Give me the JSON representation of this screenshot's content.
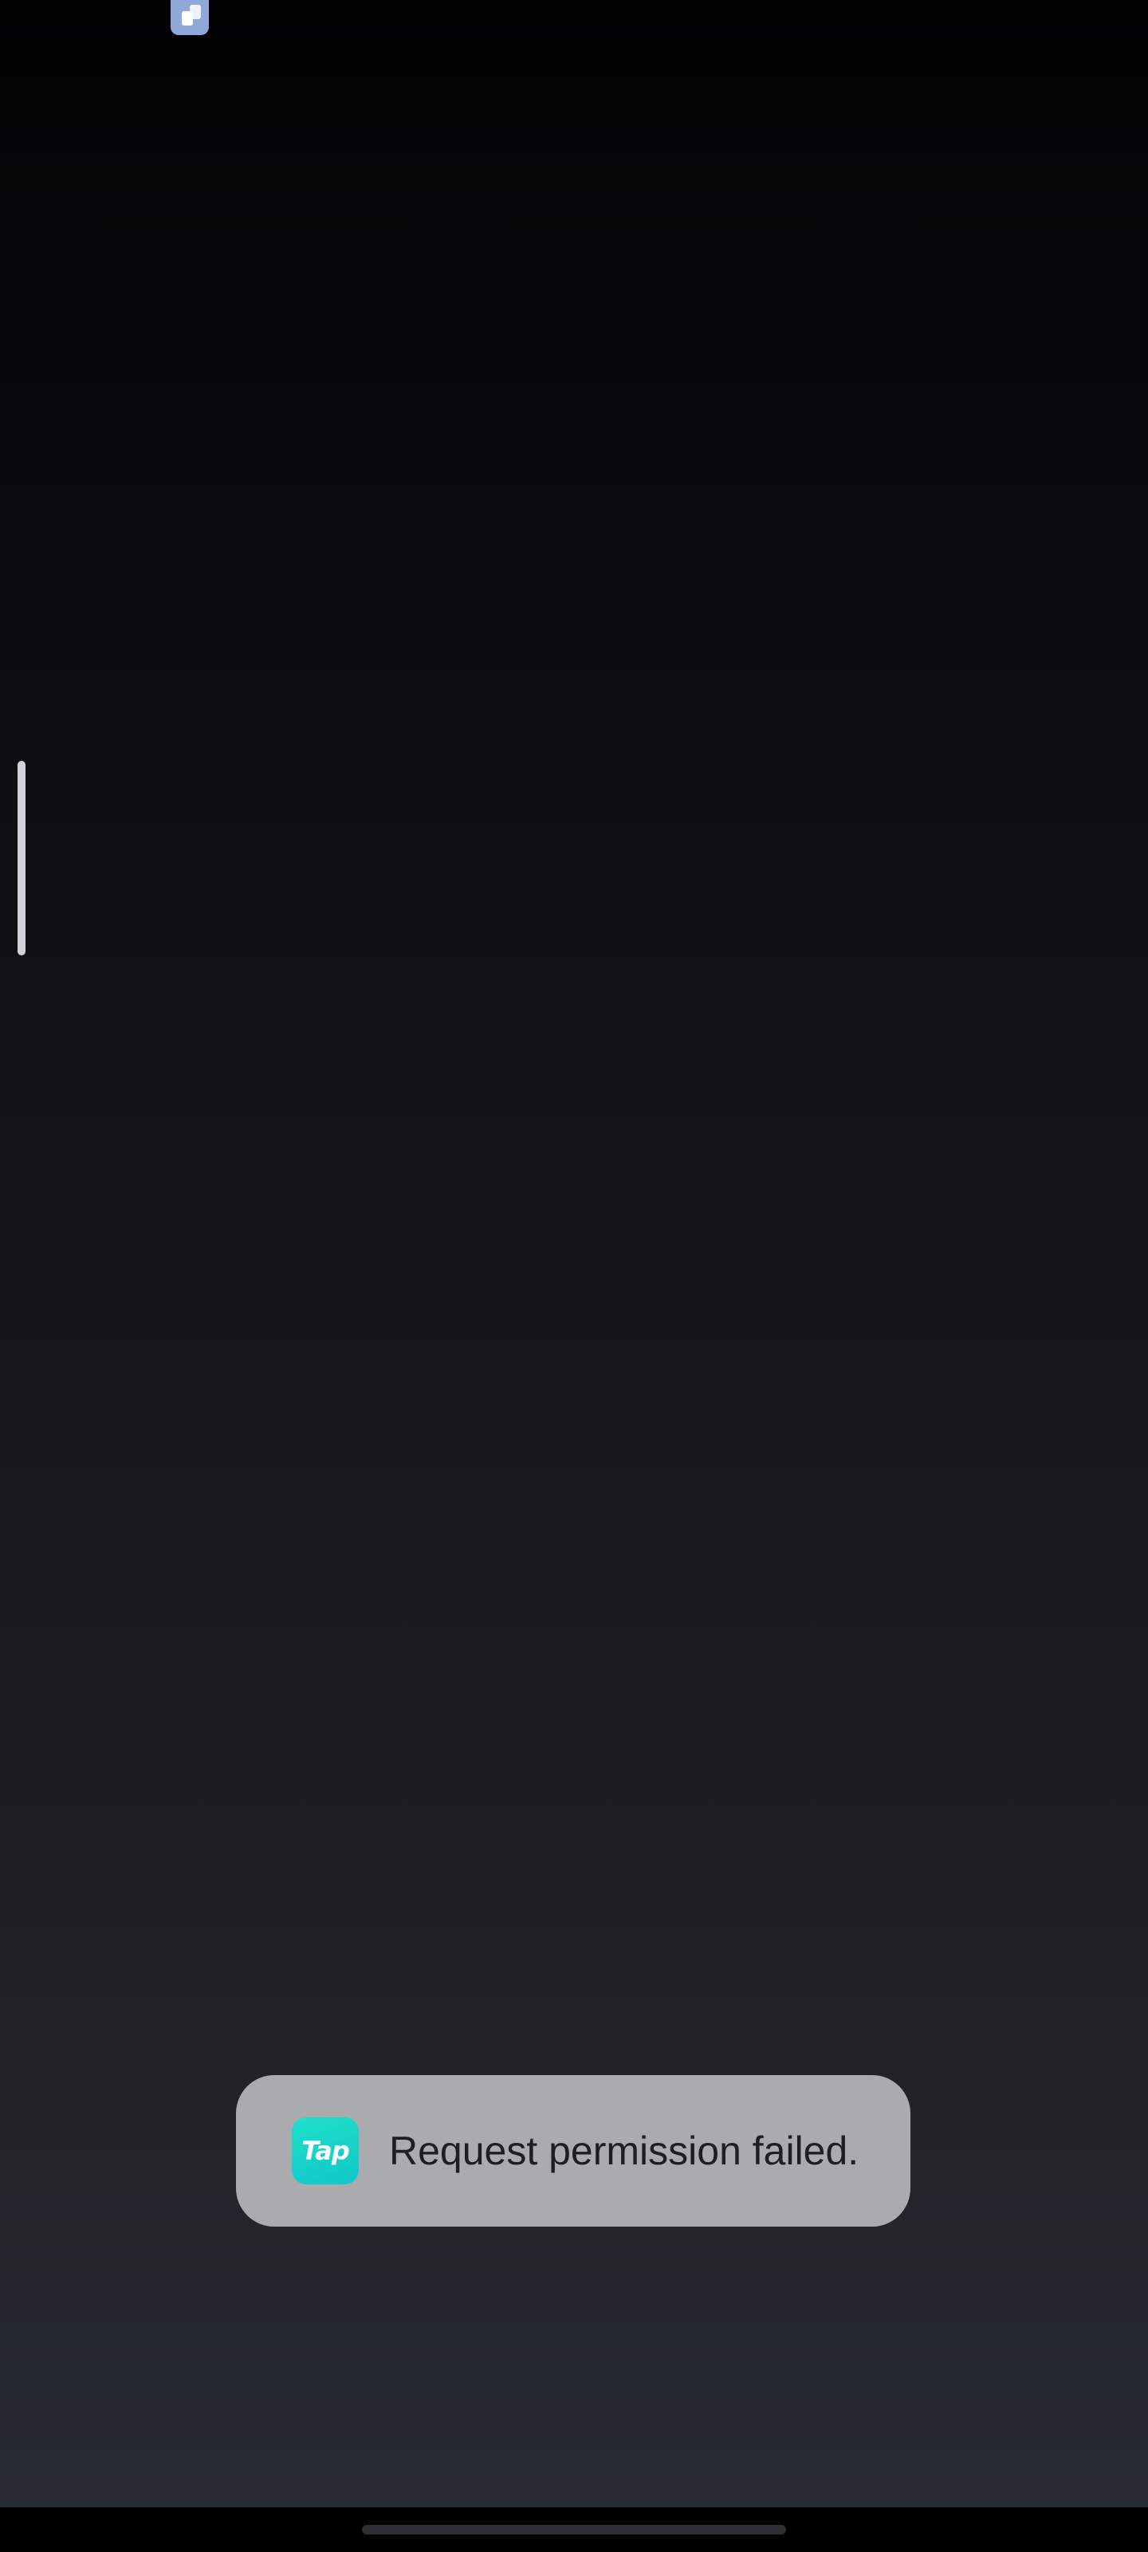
{
  "overlay": {
    "floating_icon": "multi-window-icon"
  },
  "toast": {
    "app_icon_label": "Tap",
    "message": "Request permission failed."
  },
  "colors": {
    "toast_background": "#a9abae",
    "app_icon_accent": "#1fe0c8",
    "floating_icon_color": "#8fa8d8"
  }
}
